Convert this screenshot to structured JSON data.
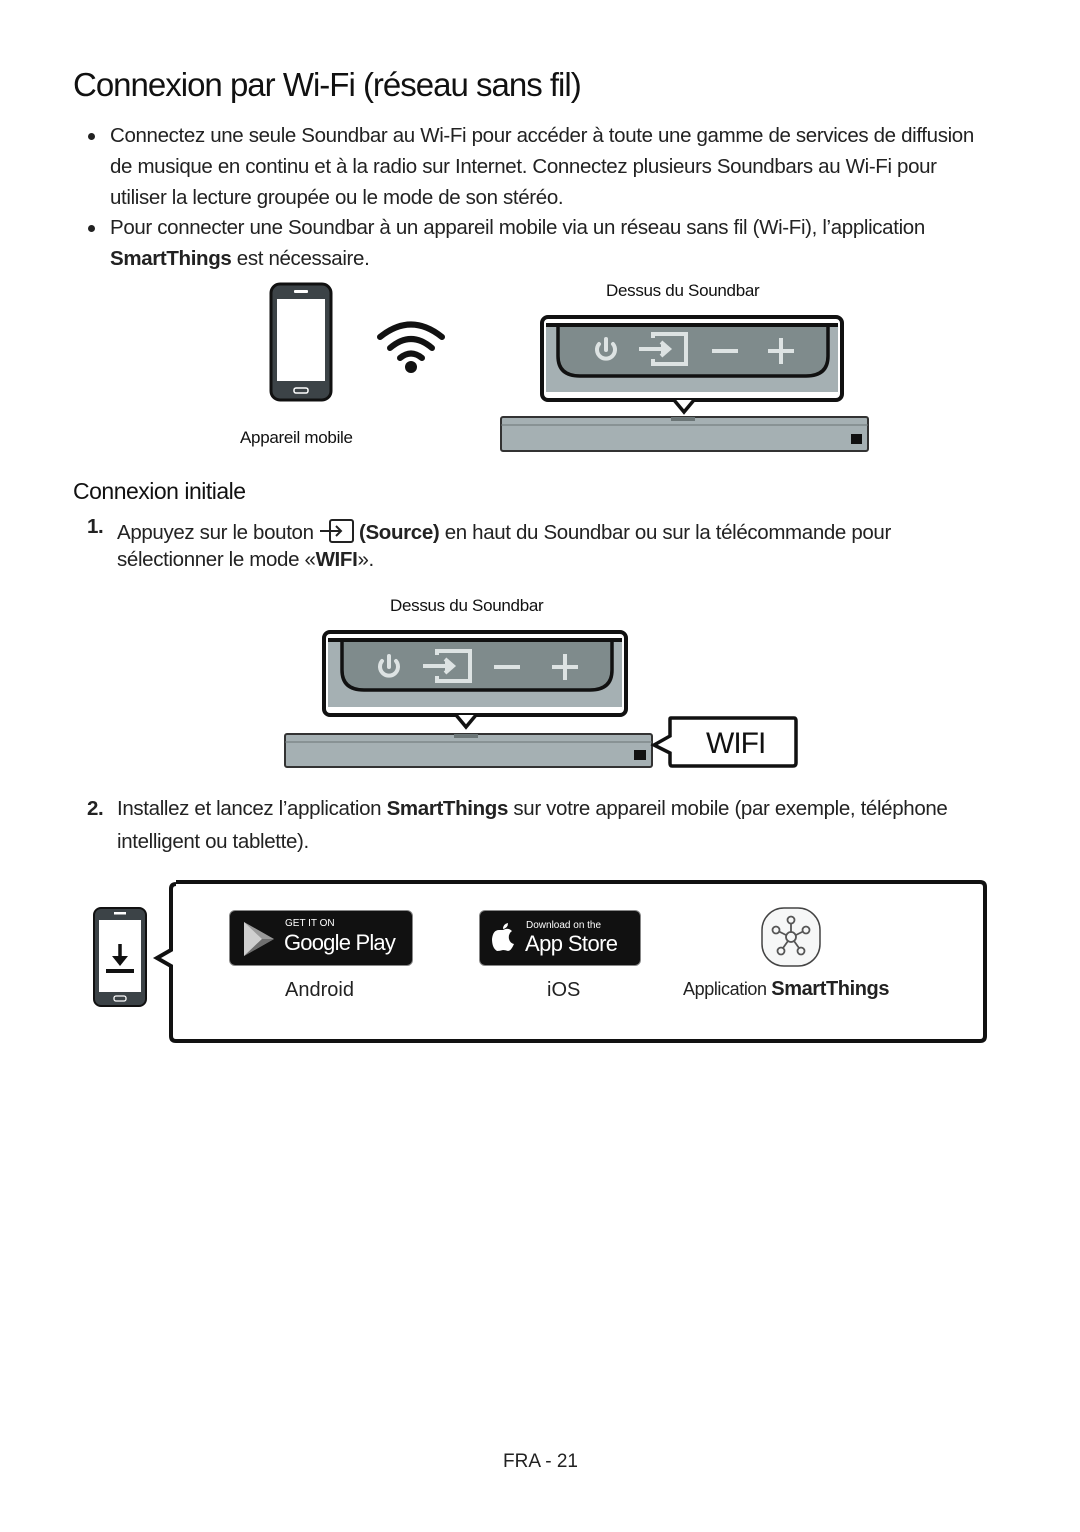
{
  "title": "Connexion par Wi-Fi (réseau sans fil)",
  "bullets": [
    {
      "lines": [
        "Connectez une seule Soundbar au Wi-Fi pour accéder à toute une gamme de services de diffusion",
        "de musique en continu et à la radio sur Internet. Connectez plusieurs Soundbars au Wi-Fi pour",
        "utiliser la lecture groupée ou le mode de son stéréo."
      ]
    },
    {
      "line1": "Pour connecter une Soundbar à un appareil mobile via un réseau sans fil (Wi-Fi), l’application",
      "bold": "SmartThings",
      "rest": " est nécessaire."
    }
  ],
  "figure1": {
    "soundbar_caption": "Dessus du Soundbar",
    "mobile_caption": "Appareil mobile"
  },
  "section": {
    "title": "Connexion initiale"
  },
  "steps": [
    {
      "num": "1.",
      "pre": "Appuyez sur le bouton ",
      "bold": "(Source)",
      "post": " en haut du Soundbar ou sur la télécommande pour",
      "line2_pre": "sélectionner le mode  «",
      "line2_bold": "WIFI",
      "line2_post": "»."
    },
    {
      "num": "2.",
      "pre": "Installez et lancez l’application ",
      "bold": "SmartThings",
      "post": " sur votre appareil mobile (par exemple, téléphone",
      "line2": "intelligent ou tablette)."
    }
  ],
  "figure2": {
    "soundbar_caption": "Dessus du Soundbar",
    "display": "WIFI"
  },
  "apps": {
    "google_play": {
      "small": "GET IT ON",
      "big": "Google Play",
      "label": "Android"
    },
    "app_store": {
      "small": "Download on the",
      "big": "App Store",
      "label": "iOS"
    },
    "smartthings": {
      "label_pre": "Application ",
      "label_bold": "SmartThings"
    }
  },
  "footer": {
    "page": "FRA - 21"
  },
  "icons": [
    "power-icon",
    "source-icon",
    "minus-icon",
    "plus-icon",
    "wifi-icon",
    "phone-icon",
    "download-icon",
    "google-play-icon",
    "apple-icon",
    "smartthings-icon"
  ]
}
